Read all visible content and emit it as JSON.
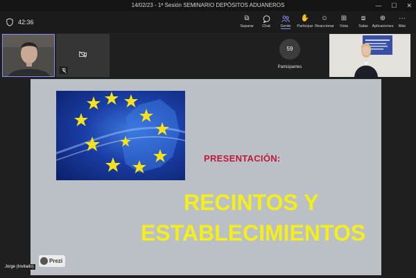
{
  "window": {
    "title": "14/02/23 - 1ª Sesión SEMINARIO DEPÓSITOS ADUANEROS"
  },
  "meeting": {
    "timer": "42:36"
  },
  "toolbar": {
    "items": [
      {
        "label": "Separar",
        "icon": "pop-out-icon"
      },
      {
        "label": "Chat",
        "icon": "chat-icon"
      },
      {
        "label": "Gente",
        "icon": "people-icon"
      },
      {
        "label": "Participar",
        "icon": "raise-hand-icon"
      },
      {
        "label": "Reaccionar",
        "icon": "smile-icon"
      },
      {
        "label": "Vista",
        "icon": "view-grid-icon"
      },
      {
        "label": "Salas",
        "icon": "rooms-icon"
      },
      {
        "label": "Aplicaciones",
        "icon": "apps-add-icon"
      },
      {
        "label": "Más",
        "icon": "more-icon"
      }
    ],
    "active": "Gente"
  },
  "participants": {
    "count": "59",
    "label": "Participantes"
  },
  "slide": {
    "presentation_label": "PRESENTACIÓN:",
    "title_line1": "RECINTOS Y",
    "title_line2": "ESTABLECIMIENTOS",
    "badge": "Prezi"
  },
  "speaker": {
    "name": "Jorge (Invitado)"
  },
  "colors": {
    "accent": "#8b8cf7",
    "slide_bg": "#bac0c6",
    "title": "#f4ef1a",
    "subtitle": "#c0173a"
  }
}
